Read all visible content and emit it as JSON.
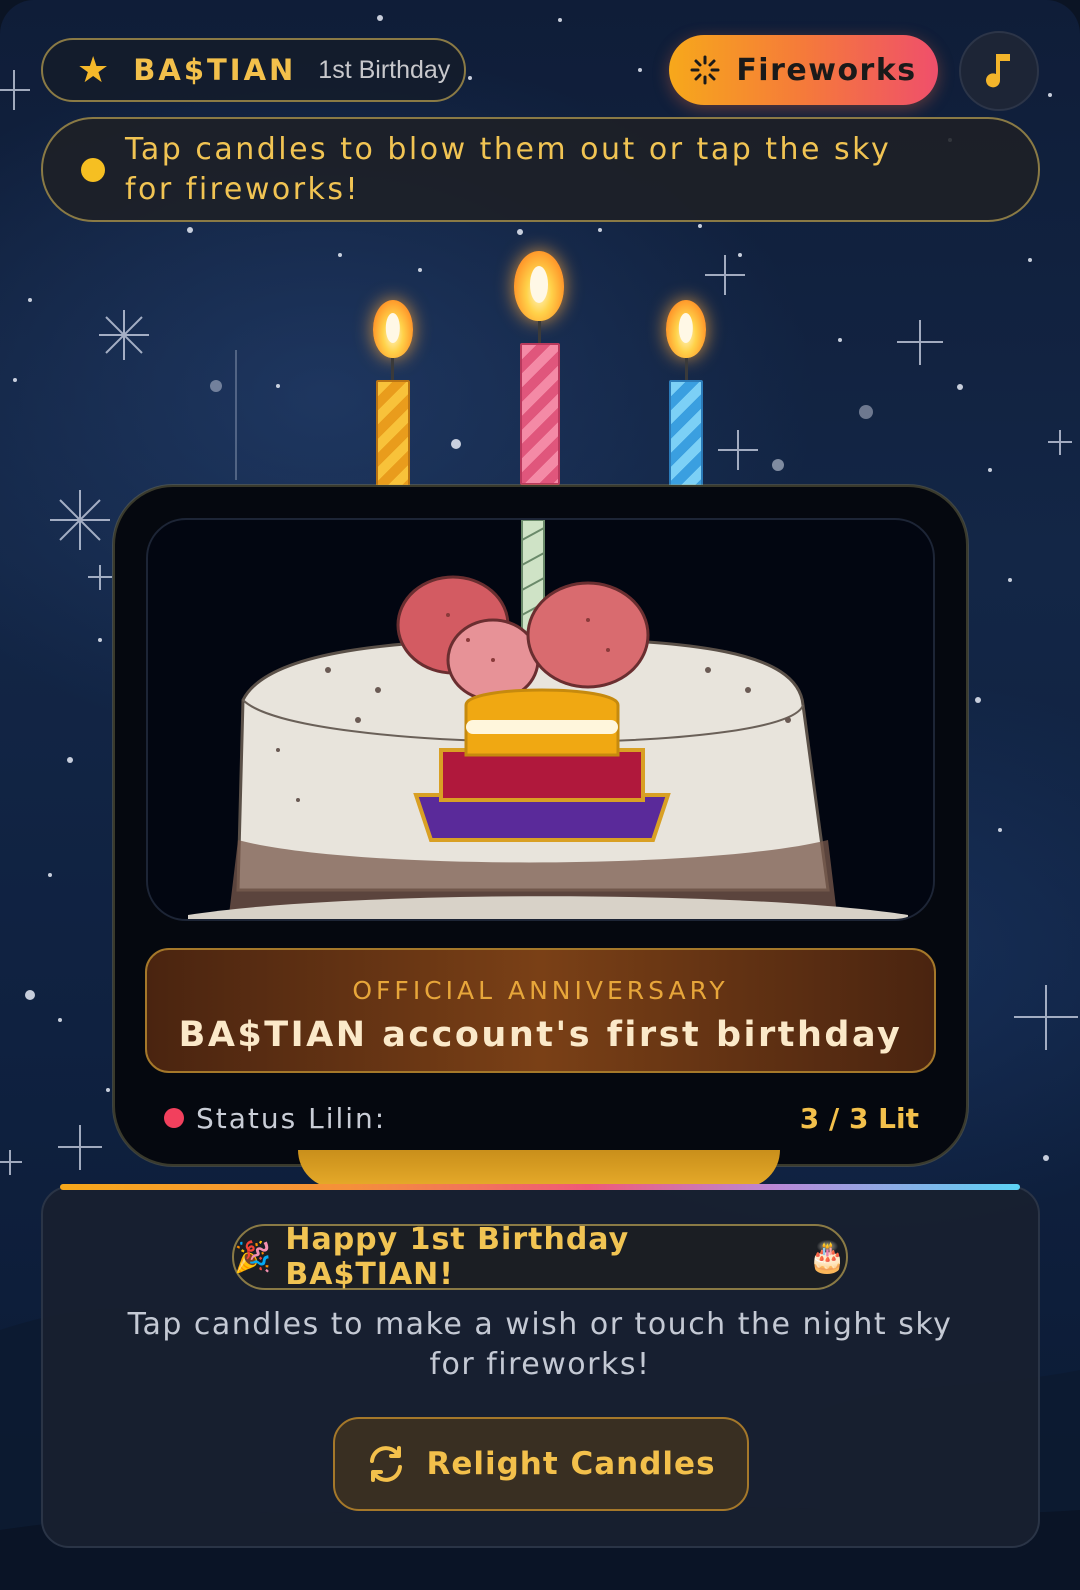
{
  "header": {
    "star_icon": "star-icon",
    "name": "BA$TIAN",
    "subtitle": "1st Birthday"
  },
  "actions": {
    "fireworks_label": "Fireworks",
    "fireworks_icon": "sparkle-burst-icon",
    "music_icon": "music-note-icon"
  },
  "hint": {
    "text": "Tap candles to blow them out or tap the sky for fireworks!"
  },
  "candles": [
    {
      "color": "#f6b12a",
      "lit": true
    },
    {
      "color": "#ee6a8a",
      "lit": true
    },
    {
      "color": "#4aaee8",
      "lit": true
    }
  ],
  "cake_card": {
    "anniversary_label": "OFFICIAL ANNIVERSARY",
    "anniversary_title": "BA$TIAN account's first birthday",
    "status_label": "Status Lilin:",
    "status_value": "3 / 3 Lit"
  },
  "bottom": {
    "greeting_emoji_left": "🎉",
    "greeting": "Happy 1st Birthday BA$TIAN!",
    "greeting_emoji_right": "🎂",
    "wish_text": "Tap candles to make a wish or touch the night sky for fireworks!",
    "relight_label": "Relight Candles",
    "relight_icon": "refresh-icon"
  },
  "colors": {
    "accent_gold": "#f3c04b",
    "fireworks_gradient_start": "#f7a81b",
    "fireworks_gradient_end": "#ef4f6b",
    "status_dot": "#f2405d"
  }
}
